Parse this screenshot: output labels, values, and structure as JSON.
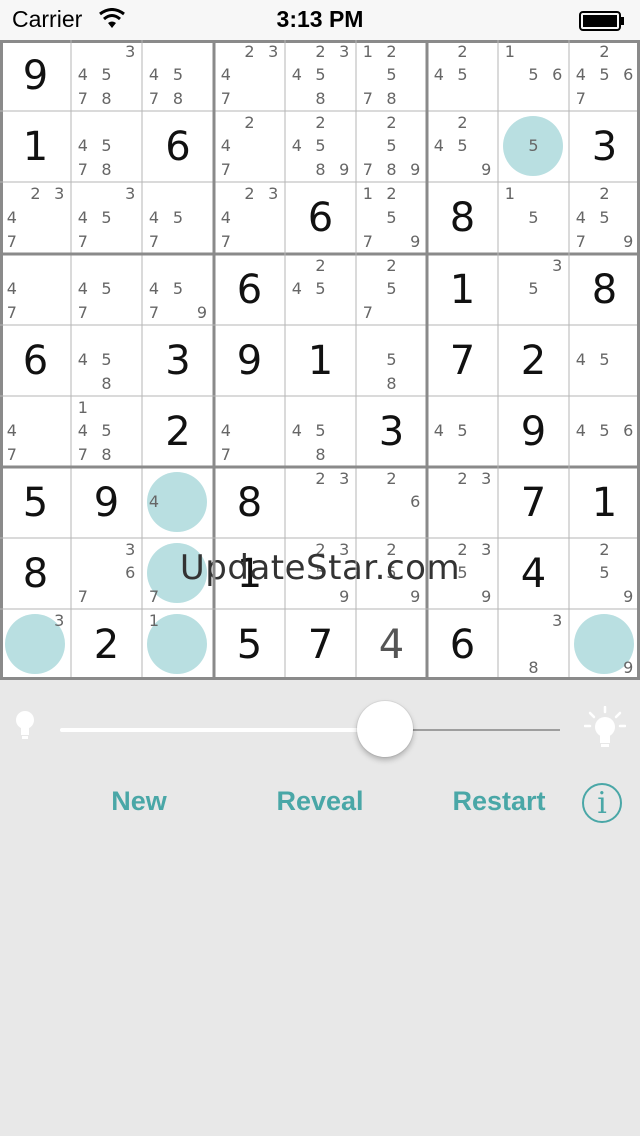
{
  "status": {
    "carrier": "Carrier",
    "time": "3:13 PM"
  },
  "watermark": "UpdateStar.com",
  "grid": [
    [
      {
        "v": "9"
      },
      {
        "n": [
          "3",
          "4",
          "5",
          "7",
          "8"
        ]
      },
      {
        "n": [
          "4",
          "5",
          "7",
          "8"
        ]
      },
      {
        "n": [
          "2",
          "3",
          "4",
          "7"
        ]
      },
      {
        "n": [
          "2",
          "3",
          "4",
          "5",
          "8"
        ]
      },
      {
        "n": [
          "1",
          "2",
          "5",
          "7",
          "8"
        ]
      },
      {
        "n": [
          "2",
          "4",
          "5"
        ]
      },
      {
        "n": [
          "1",
          "5",
          "6"
        ]
      },
      {
        "n": [
          "2",
          "4",
          "5",
          "6",
          "7"
        ]
      }
    ],
    [
      {
        "v": "1"
      },
      {
        "n": [
          "4",
          "5",
          "7",
          "8"
        ]
      },
      {
        "v": "6"
      },
      {
        "n": [
          "2",
          "4",
          "7"
        ]
      },
      {
        "n": [
          "2",
          "4",
          "5",
          "8",
          "9"
        ]
      },
      {
        "n": [
          "2",
          "5",
          "7",
          "8",
          "9"
        ]
      },
      {
        "n": [
          "2",
          "4",
          "5",
          "9"
        ]
      },
      {
        "b": "5"
      },
      {
        "v": "3"
      }
    ],
    [
      {
        "n": [
          "2",
          "3",
          "4",
          "7"
        ]
      },
      {
        "n": [
          "3",
          "4",
          "5",
          "7"
        ]
      },
      {
        "n": [
          "4",
          "5",
          "7"
        ]
      },
      {
        "n": [
          "2",
          "3",
          "4",
          "7"
        ]
      },
      {
        "v": "6"
      },
      {
        "n": [
          "1",
          "2",
          "5",
          "7",
          "9"
        ]
      },
      {
        "v": "8"
      },
      {
        "n": [
          "1",
          "5"
        ]
      },
      {
        "n": [
          "2",
          "4",
          "5",
          "7",
          "9"
        ]
      }
    ],
    [
      {
        "n": [
          "4",
          "7"
        ]
      },
      {
        "n": [
          "4",
          "5",
          "7"
        ]
      },
      {
        "n": [
          "4",
          "5",
          "7",
          "9"
        ]
      },
      {
        "v": "6"
      },
      {
        "n": [
          "2",
          "4",
          "5"
        ]
      },
      {
        "n": [
          "2",
          "5",
          "7"
        ]
      },
      {
        "v": "1"
      },
      {
        "n": [
          "3",
          "5"
        ]
      },
      {
        "v": "8"
      }
    ],
    [
      {
        "v": "6"
      },
      {
        "n": [
          "4",
          "5",
          "8"
        ]
      },
      {
        "v": "3"
      },
      {
        "v": "9"
      },
      {
        "v": "1"
      },
      {
        "n": [
          "5",
          "8"
        ]
      },
      {
        "v": "7"
      },
      {
        "v": "2"
      },
      {
        "n": [
          "4",
          "5"
        ]
      }
    ],
    [
      {
        "n": [
          "4",
          "7"
        ]
      },
      {
        "n": [
          "1",
          "4",
          "5",
          "7",
          "8"
        ]
      },
      {
        "v": "2"
      },
      {
        "n": [
          "4",
          "7"
        ]
      },
      {
        "n": [
          "4",
          "5",
          "8"
        ]
      },
      {
        "v": "3"
      },
      {
        "n": [
          "4",
          "5"
        ]
      },
      {
        "v": "9"
      },
      {
        "n": [
          "4",
          "5",
          "6"
        ]
      }
    ],
    [
      {
        "v": "5"
      },
      {
        "v": "9"
      },
      {
        "b": "4"
      },
      {
        "v": "8"
      },
      {
        "n": [
          "2",
          "3"
        ]
      },
      {
        "n": [
          "2",
          "6"
        ]
      },
      {
        "n": [
          "2",
          "3"
        ]
      },
      {
        "v": "7"
      },
      {
        "v": "1"
      }
    ],
    [
      {
        "v": "8"
      },
      {
        "n": [
          "3",
          "6",
          "7"
        ]
      },
      {
        "b": "7"
      },
      {
        "v": "1"
      },
      {
        "n": [
          "2",
          "3",
          "5",
          "9"
        ]
      },
      {
        "n": [
          "2",
          "5",
          "9"
        ]
      },
      {
        "n": [
          "2",
          "3",
          "5",
          "9"
        ]
      },
      {
        "v": "4"
      },
      {
        "n": [
          "2",
          "5",
          "9"
        ]
      }
    ],
    [
      {
        "b": "3"
      },
      {
        "v": "2"
      },
      {
        "b": "1"
      },
      {
        "v": "5"
      },
      {
        "v": "7"
      },
      {
        "v": "4",
        "g": true
      },
      {
        "v": "6"
      },
      {
        "n": [
          "3",
          "8"
        ]
      },
      {
        "b": "9"
      }
    ]
  ],
  "controls": {
    "slider_value_fraction": 0.64,
    "new_label": "New",
    "reveal_label": "Reveal",
    "restart_label": "Restart",
    "info_label": "i",
    "accent": "#4aa7a7",
    "bubble_color": "#b9dfe1"
  }
}
